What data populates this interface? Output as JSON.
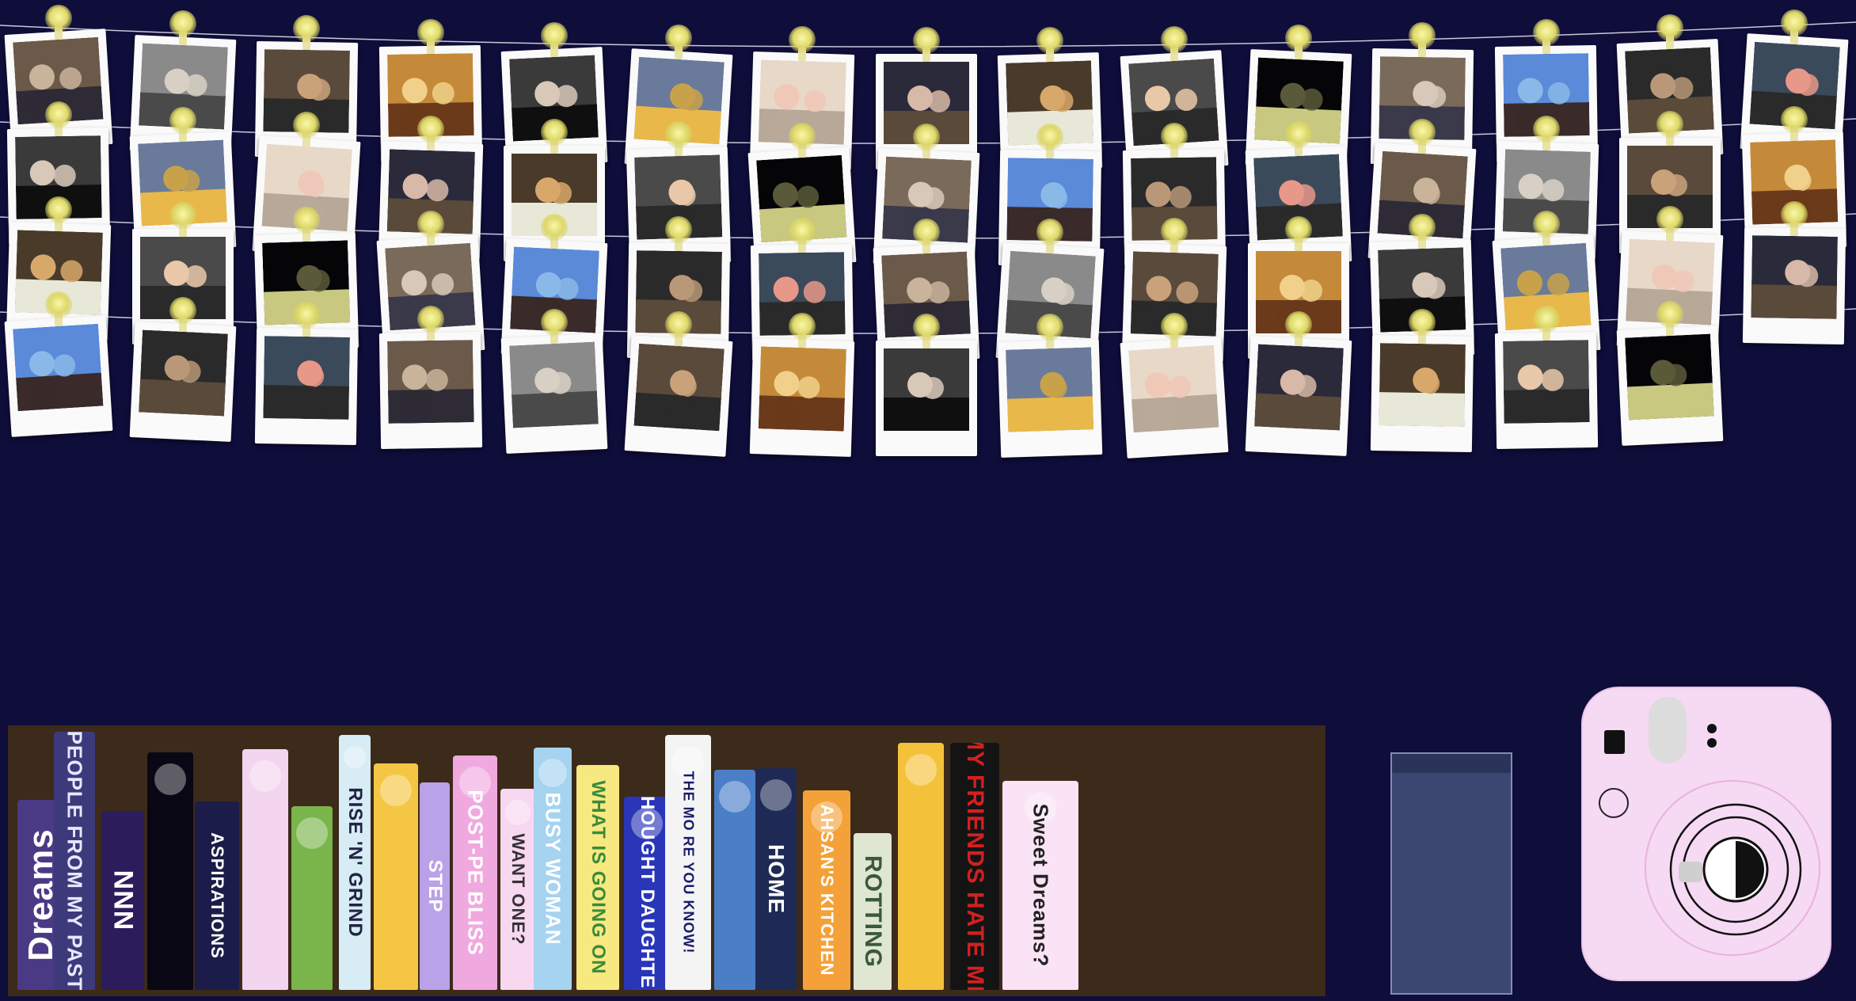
{
  "colors": {
    "background": "#0f0d3a",
    "shelf": "#3c2a1a",
    "light": "#ece88a",
    "polaroid_frame": "#fafafa",
    "camera": "#f6d9f3"
  },
  "photo_wall": {
    "rows": 4,
    "polaroids_per_row": [
      15,
      15,
      15,
      14
    ],
    "lights_per_row": 15
  },
  "bookshelf": {
    "books": [
      {
        "id": "dreams",
        "title": "Dreams",
        "color": "#4a3a86",
        "text_color": "#ffffff",
        "icon": ""
      },
      {
        "id": "past",
        "title": "PEOPLE FROM MY PAST",
        "color": "#3c3a7a",
        "text_color": "#e7e7ff",
        "icon": ""
      },
      {
        "id": "nnn",
        "title": "NNN",
        "color": "#2c1c5c",
        "text_color": "#ffffff",
        "icon": ""
      },
      {
        "id": "space",
        "title": "",
        "color": "#0a0714",
        "text_color": "#ffffff",
        "icon": "astronaut-icon"
      },
      {
        "id": "aspirations",
        "title": "ASPIRATIONS",
        "color": "#1c1c4a",
        "text_color": "#ffffff",
        "icon": ""
      },
      {
        "id": "clouds",
        "title": "",
        "color": "#f3d5ef",
        "text_color": "#ffffff",
        "icon": "closed-eye-icon"
      },
      {
        "id": "toothbrush",
        "title": "",
        "color": "#79b54a",
        "text_color": "#ffffff",
        "icon": "toothbrush-icon"
      },
      {
        "id": "grind",
        "title": "RISE 'N' GRIND",
        "color": "#d7ecf5",
        "text_color": "#222244",
        "icon": "strawberry-icon"
      },
      {
        "id": "desk",
        "title": "",
        "color": "#f4c644",
        "text_color": "#222222",
        "icon": "desk-icon"
      },
      {
        "id": "step",
        "title": "STEP",
        "color": "#b9a2e8",
        "text_color": "#ffffff",
        "icon": ""
      },
      {
        "id": "postpe",
        "title": "POST-PE BLISS",
        "color": "#f0a9df",
        "text_color": "#ffffff",
        "icon": "lips-icon"
      },
      {
        "id": "wantone",
        "title": "WANT ONE?",
        "color": "#f8d7f0",
        "text_color": "#333333",
        "icon": "donut-icon"
      },
      {
        "id": "busywoman",
        "title": "BUSY WOMAN",
        "color": "#a5d3f0",
        "text_color": "#ffffff",
        "icon": "laptop-girl-icon"
      },
      {
        "id": "whatgoingon",
        "title": "WHAT IS GOING ON",
        "color": "#f8e880",
        "text_color": "#3a8a3a",
        "icon": ""
      },
      {
        "id": "thought",
        "title": "THOUGHT DAUGHTER",
        "color": "#2a36b8",
        "text_color": "#ffffff",
        "icon": "brain-icon"
      },
      {
        "id": "dots",
        "title": "THE MO RE YOU KNOW!",
        "color": "#f4f4f4",
        "text_color": "#1a1a6a",
        "icon": "dots-icon"
      },
      {
        "id": "sky",
        "title": "",
        "color": "#4a7fc8",
        "text_color": "#ffffff",
        "icon": "sunset-icon"
      },
      {
        "id": "home",
        "title": "HOME",
        "color": "#1e2a55",
        "text_color": "#ffffff",
        "icon": "moon-icon"
      },
      {
        "id": "ahsans",
        "title": "AHSAN'S KITCHEN",
        "color": "#f4a13a",
        "text_color": "#ffffff",
        "icon": "plate-icon"
      },
      {
        "id": "rotting",
        "title": "ROTTING",
        "color": "#dfe6d2",
        "text_color": "#3a5a3a",
        "icon": ""
      },
      {
        "id": "hearts",
        "title": "",
        "color": "#f4c23a",
        "text_color": "#222222",
        "icon": "hearts-icon"
      },
      {
        "id": "friends",
        "title": "MY FRIENDS HATE ME",
        "color": "#141414",
        "text_color": "#d32020",
        "icon": ""
      },
      {
        "id": "sweet",
        "title": "Sweet Dreams?",
        "color": "#f9e3f4",
        "text_color": "#222222",
        "icon": "pillow-icon"
      }
    ]
  },
  "glass": {
    "icon": "empty-glass-icon"
  },
  "camera": {
    "icon": "instant-camera-icon"
  }
}
